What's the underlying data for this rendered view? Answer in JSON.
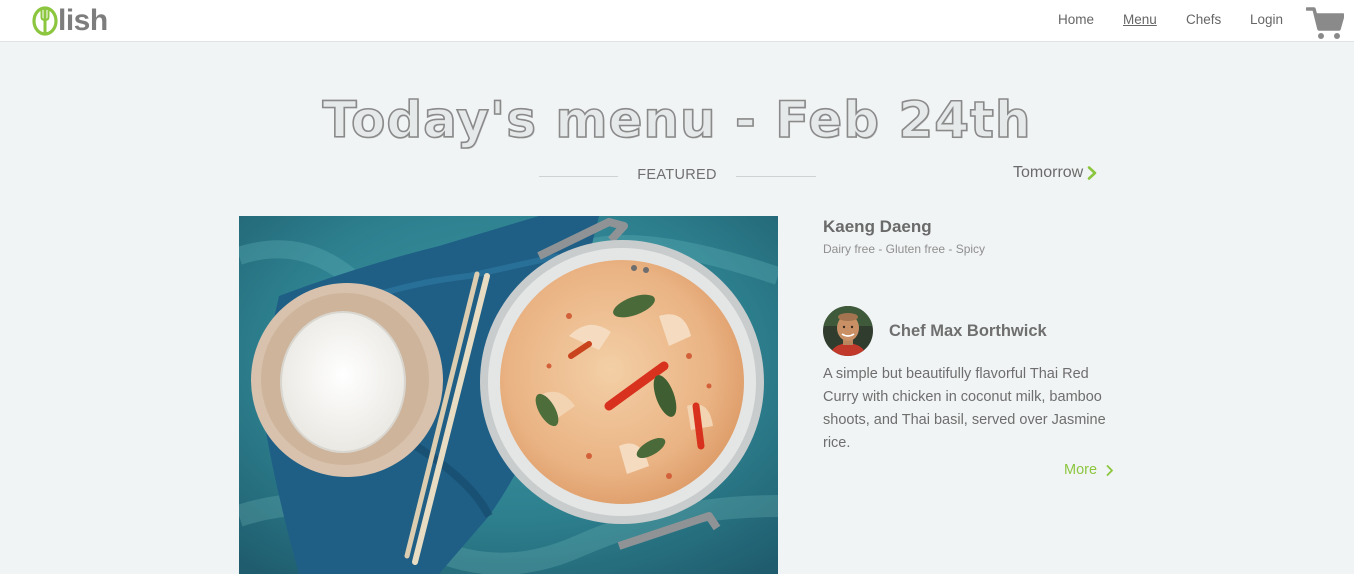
{
  "brand": {
    "logo_text": "lish",
    "accent_color": "#8cc63f"
  },
  "nav": {
    "home": "Home",
    "menu": "Menu",
    "chefs": "Chefs",
    "login": "Login",
    "active": "Menu",
    "cart_icon": "cart-icon"
  },
  "page": {
    "title": "Today's menu - Feb 24th",
    "featured_label": "FEATURED",
    "next_day_label": "Tomorrow"
  },
  "dish": {
    "name": "Kaeng Daeng",
    "tags": "Dairy free - Gluten free - Spicy",
    "chef_name": "Chef Max Borthwick",
    "description": "A simple but beautifully flavorful Thai Red Curry with chicken in coconut milk, bamboo shoots, and Thai basil, served over Jasmine rice.",
    "more_label": "More"
  }
}
